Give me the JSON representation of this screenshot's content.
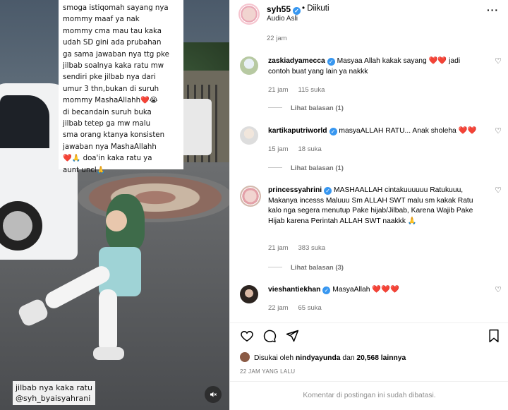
{
  "video": {
    "caption_text": "smoga istiqomah sayang nya\nmommy maaf ya nak\nmommy cma mau tau kaka\nudah SD gini ada prubahan\nga sama jawaban nya ttg pke\njilbab soalnya kaka ratu mw\nsendiri pke jilbab nya dari\numur 3 thn,bukan di suruh\nmommy MashaAllahh❤️😭\ndi becandain suruh buka\njilbab tetep ga mw malu\nsma orang ktanya konsisten\njawaban nya MashaAllahh\n❤️🙏 doa'in kaka ratu ya\naunt uncl🙏",
    "overlay_line1": "jilbab nya kaka ratu",
    "overlay_line2": "@syh_byaisyahrani"
  },
  "header": {
    "username": "syh55",
    "follow_status": "• Diikuti",
    "audio": "Audio Asli"
  },
  "post_time": "22 jam",
  "comments": [
    {
      "user": "zaskiadyamecca",
      "text": "Masyaa Allah kakak sayang",
      "hearts": "❤️❤️",
      "text_after": "jadi contoh buat yang lain ya nakkk",
      "time": "21 jam",
      "likes": "115 suka",
      "replies": "Lihat balasan (1)"
    },
    {
      "user": "kartikaputriworld",
      "text": "masyaALLAH RATU... Anak sholeha",
      "hearts": "❤️❤️",
      "time": "15 jam",
      "likes": "18 suka",
      "replies": "Lihat balasan (1)"
    },
    {
      "user": "princessyahrini",
      "text": "MASHAALLAH cintakuuuuuu Ratukuuu, Makanya incesss Maluuu Sm ALLAH SWT malu sm kakak Ratu kalo nga segera menutup Pake hijab/Jilbab, Karena Wajib Pake Hijab karena Perintah ALLAH SWT naakkk",
      "emoji": "🙏",
      "time": "21 jam",
      "likes": "383 suka",
      "replies": "Lihat balasan (3)"
    },
    {
      "user": "vieshantiekhan",
      "text": "MasyaAllah",
      "hearts": "❤️❤️❤️",
      "time": "22 jam",
      "likes": "65 suka"
    }
  ],
  "liked_by": {
    "prefix": "Disukai oleh",
    "user": "nindyayunda",
    "middle": "dan",
    "count": "20,568 lainnya"
  },
  "post_date": "22 JAM YANG LALU",
  "footer_text": "Komentar di postingan ini sudah dibatasi.",
  "colors": {
    "verified": "#3897f0",
    "heart": "#e0142b",
    "muted_text": "#737373"
  }
}
